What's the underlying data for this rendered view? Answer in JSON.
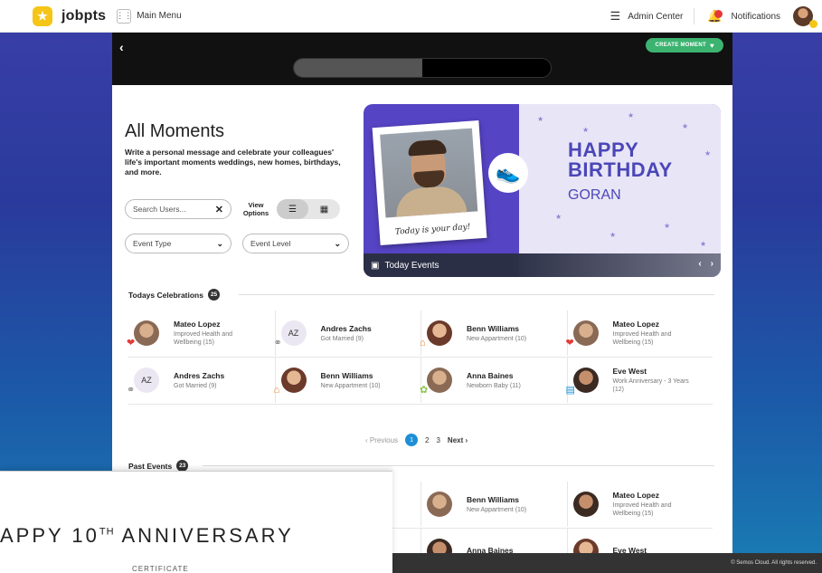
{
  "app": {
    "brand": "jobpts",
    "main_menu": "Main Menu",
    "admin_center": "Admin Center",
    "notifications": "Notifications"
  },
  "header": {
    "create_moment": "CREATE MOMENT",
    "progress_fraction": 0.5
  },
  "page": {
    "title": "All Moments",
    "subtitle": "Write a personal message and celebrate your colleagues' life's important moments weddings, new homes, birthdays, and more."
  },
  "filters": {
    "search_placeholder": "Search Users...",
    "view_options": "View Options",
    "event_type": "Event Type",
    "event_level": "Event Level"
  },
  "banner": {
    "caption": "Today is your day!",
    "line1": "HAPPY",
    "line2": "BIRTHDAY",
    "name": "GORAN",
    "today_events": "Today Events"
  },
  "todays": {
    "label": "Todays Celebrations",
    "count": "25",
    "rows": [
      [
        {
          "name": "Mateo Lopez",
          "sub": "Improved Health and Wellbeing (15)",
          "icon": "heart-icon"
        },
        {
          "name": "Andres Zachs",
          "sub": "Got Married (9)",
          "icon": "rings-icon",
          "initials": "AZ"
        },
        {
          "name": "Benn Williams",
          "sub": "New Appartment (10)",
          "icon": "house-icon"
        },
        {
          "name": "Mateo Lopez",
          "sub": "Improved Health and Wellbeing (15)",
          "icon": "heart-icon"
        }
      ],
      [
        {
          "name": "Andres Zachs",
          "sub": "Got Married (9)",
          "icon": "rings-icon",
          "initials": "AZ"
        },
        {
          "name": "Benn Williams",
          "sub": "New Appartment (10)",
          "icon": "house-icon"
        },
        {
          "name": "Anna Baines",
          "sub": "Newborn Baby (11)",
          "icon": "baby-icon"
        },
        {
          "name": "Eve West",
          "sub": "Work Anniversary - 3 Years (12)",
          "icon": "briefcase-icon"
        }
      ]
    ]
  },
  "pagination": {
    "previous": "Previous",
    "pages": [
      "1",
      "2",
      "3"
    ],
    "next": "Next"
  },
  "past": {
    "label": "Past Events",
    "count": "23",
    "rows": [
      [
        {
          "name": "Benn Williams",
          "sub": "New Appartment (10)"
        },
        {
          "name": "Mateo Lopez",
          "sub": "Improved Health and Wellbeing (15)"
        }
      ],
      [
        {
          "name": "Anna Baines",
          "sub": ""
        },
        {
          "name": "Eve West",
          "sub": ""
        }
      ]
    ]
  },
  "certificate": {
    "title_pre": "APPY 10",
    "title_sup": "TH",
    "title_post": " ANNIVERSARY",
    "sub": "CERTIFICATE"
  },
  "footer": {
    "text": "© Semos Cloud. All rights reserved."
  },
  "colors": {
    "accent": "#1e8fd6",
    "create_button": "#3cb371",
    "banner_purple": "#5544c4",
    "logo_yellow": "#f5c518"
  }
}
